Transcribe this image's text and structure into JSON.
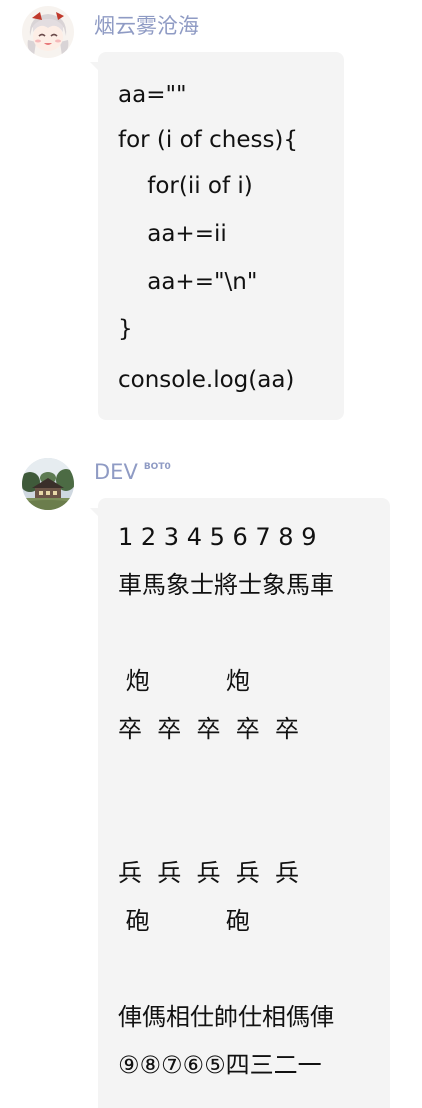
{
  "messages": [
    {
      "sender": "烟云雾沧海",
      "code_lines": [
        "aa=\"\"",
        "for (i of chess){",
        "    for(ii of i)",
        "    aa+=ii",
        "    aa+=\"\\n\"",
        "}",
        "console.log(aa)"
      ]
    },
    {
      "sender": "DEV",
      "badge": "BOT0",
      "board_lines": [
        "1 2 3 4 5 6 7 8 9",
        "車馬象士將士象馬車",
        "",
        " 炮          炮",
        "卒  卒  卒  卒  卒",
        "",
        "",
        "兵  兵  兵  兵  兵",
        " 砲          砲",
        "",
        "俥傌相仕帥仕相傌俥",
        "⑨⑧⑦⑥⑤四三二一"
      ]
    }
  ],
  "colors": {
    "sender_name": "#8f9bc4",
    "bubble_bg": "#f4f4f4",
    "text": "#111111"
  },
  "icons": {
    "avatar1": "anime-character-avatar",
    "avatar2": "landscape-house-avatar"
  }
}
